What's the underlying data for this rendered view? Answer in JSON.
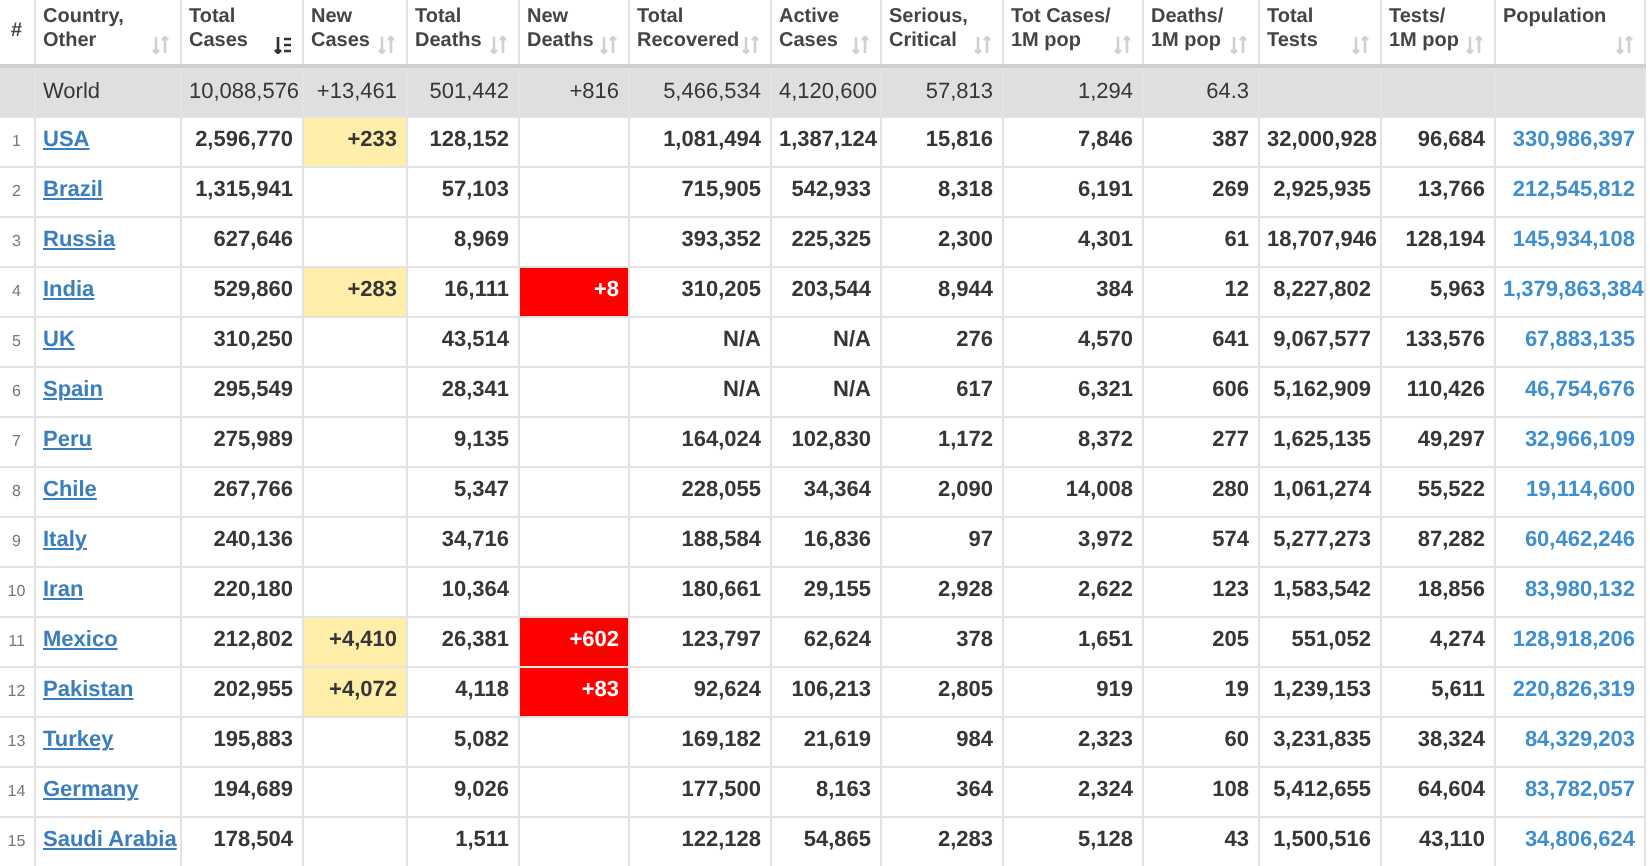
{
  "table": {
    "columns": [
      {
        "label": "#",
        "kind": "index"
      },
      {
        "label": "Country,\nOther",
        "kind": "country",
        "sorted": false
      },
      {
        "label": "Total\nCases",
        "kind": "plain",
        "sorted": true
      },
      {
        "label": "New\nCases",
        "kind": "new_cases",
        "sorted": false
      },
      {
        "label": "Total\nDeaths",
        "kind": "plain",
        "sorted": false
      },
      {
        "label": "New\nDeaths",
        "kind": "new_deaths",
        "sorted": false
      },
      {
        "label": "Total\nRecovered",
        "kind": "plain",
        "sorted": false
      },
      {
        "label": "Active\nCases",
        "kind": "plain",
        "sorted": false
      },
      {
        "label": "Serious,\nCritical",
        "kind": "plain",
        "sorted": false
      },
      {
        "label": "Tot Cases/\n1M pop",
        "kind": "plain",
        "sorted": false
      },
      {
        "label": "Deaths/\n1M pop",
        "kind": "plain",
        "sorted": false
      },
      {
        "label": "Total\nTests",
        "kind": "plain",
        "sorted": false
      },
      {
        "label": "Tests/\n1M pop",
        "kind": "plain",
        "sorted": false
      },
      {
        "label": "Population",
        "kind": "population",
        "sorted": false
      }
    ],
    "rows": [
      {
        "kind": "total",
        "cells": [
          null,
          "World",
          "10,088,576",
          "+13,461",
          "501,442",
          "+816",
          "5,466,534",
          "4,120,600",
          "57,813",
          "1,294",
          "64.3",
          null,
          null,
          null
        ]
      },
      {
        "kind": "country",
        "cells": [
          "1",
          "USA",
          "2,596,770",
          "+233",
          "128,152",
          null,
          "1,081,494",
          "1,387,124",
          "15,816",
          "7,846",
          "387",
          "32,000,928",
          "96,684",
          "330,986,397"
        ]
      },
      {
        "kind": "country",
        "cells": [
          "2",
          "Brazil",
          "1,315,941",
          null,
          "57,103",
          null,
          "715,905",
          "542,933",
          "8,318",
          "6,191",
          "269",
          "2,925,935",
          "13,766",
          "212,545,812"
        ]
      },
      {
        "kind": "country",
        "cells": [
          "3",
          "Russia",
          "627,646",
          null,
          "8,969",
          null,
          "393,352",
          "225,325",
          "2,300",
          "4,301",
          "61",
          "18,707,946",
          "128,194",
          "145,934,108"
        ]
      },
      {
        "kind": "country",
        "cells": [
          "4",
          "India",
          "529,860",
          "+283",
          "16,111",
          "+8",
          "310,205",
          "203,544",
          "8,944",
          "384",
          "12",
          "8,227,802",
          "5,963",
          "1,379,863,384"
        ]
      },
      {
        "kind": "country",
        "cells": [
          "5",
          "UK",
          "310,250",
          null,
          "43,514",
          null,
          "N/A",
          "N/A",
          "276",
          "4,570",
          "641",
          "9,067,577",
          "133,576",
          "67,883,135"
        ]
      },
      {
        "kind": "country",
        "cells": [
          "6",
          "Spain",
          "295,549",
          null,
          "28,341",
          null,
          "N/A",
          "N/A",
          "617",
          "6,321",
          "606",
          "5,162,909",
          "110,426",
          "46,754,676"
        ]
      },
      {
        "kind": "country",
        "cells": [
          "7",
          "Peru",
          "275,989",
          null,
          "9,135",
          null,
          "164,024",
          "102,830",
          "1,172",
          "8,372",
          "277",
          "1,625,135",
          "49,297",
          "32,966,109"
        ]
      },
      {
        "kind": "country",
        "cells": [
          "8",
          "Chile",
          "267,766",
          null,
          "5,347",
          null,
          "228,055",
          "34,364",
          "2,090",
          "14,008",
          "280",
          "1,061,274",
          "55,522",
          "19,114,600"
        ]
      },
      {
        "kind": "country",
        "cells": [
          "9",
          "Italy",
          "240,136",
          null,
          "34,716",
          null,
          "188,584",
          "16,836",
          "97",
          "3,972",
          "574",
          "5,277,273",
          "87,282",
          "60,462,246"
        ]
      },
      {
        "kind": "country",
        "cells": [
          "10",
          "Iran",
          "220,180",
          null,
          "10,364",
          null,
          "180,661",
          "29,155",
          "2,928",
          "2,622",
          "123",
          "1,583,542",
          "18,856",
          "83,980,132"
        ]
      },
      {
        "kind": "country",
        "cells": [
          "11",
          "Mexico",
          "212,802",
          "+4,410",
          "26,381",
          "+602",
          "123,797",
          "62,624",
          "378",
          "1,651",
          "205",
          "551,052",
          "4,274",
          "128,918,206"
        ]
      },
      {
        "kind": "country",
        "cells": [
          "12",
          "Pakistan",
          "202,955",
          "+4,072",
          "4,118",
          "+83",
          "92,624",
          "106,213",
          "2,805",
          "919",
          "19",
          "1,239,153",
          "5,611",
          "220,826,319"
        ]
      },
      {
        "kind": "country",
        "cells": [
          "13",
          "Turkey",
          "195,883",
          null,
          "5,082",
          null,
          "169,182",
          "21,619",
          "984",
          "2,323",
          "60",
          "3,231,835",
          "38,324",
          "84,329,203"
        ]
      },
      {
        "kind": "country",
        "cells": [
          "14",
          "Germany",
          "194,689",
          null,
          "9,026",
          null,
          "177,500",
          "8,163",
          "364",
          "2,324",
          "108",
          "5,412,655",
          "64,604",
          "83,782,057"
        ]
      },
      {
        "kind": "country",
        "cells": [
          "15",
          "Saudi Arabia",
          "178,504",
          null,
          "1,511",
          null,
          "122,128",
          "54,865",
          "2,283",
          "5,128",
          "43",
          "1,500,516",
          "43,110",
          "34,806,624"
        ]
      }
    ]
  }
}
